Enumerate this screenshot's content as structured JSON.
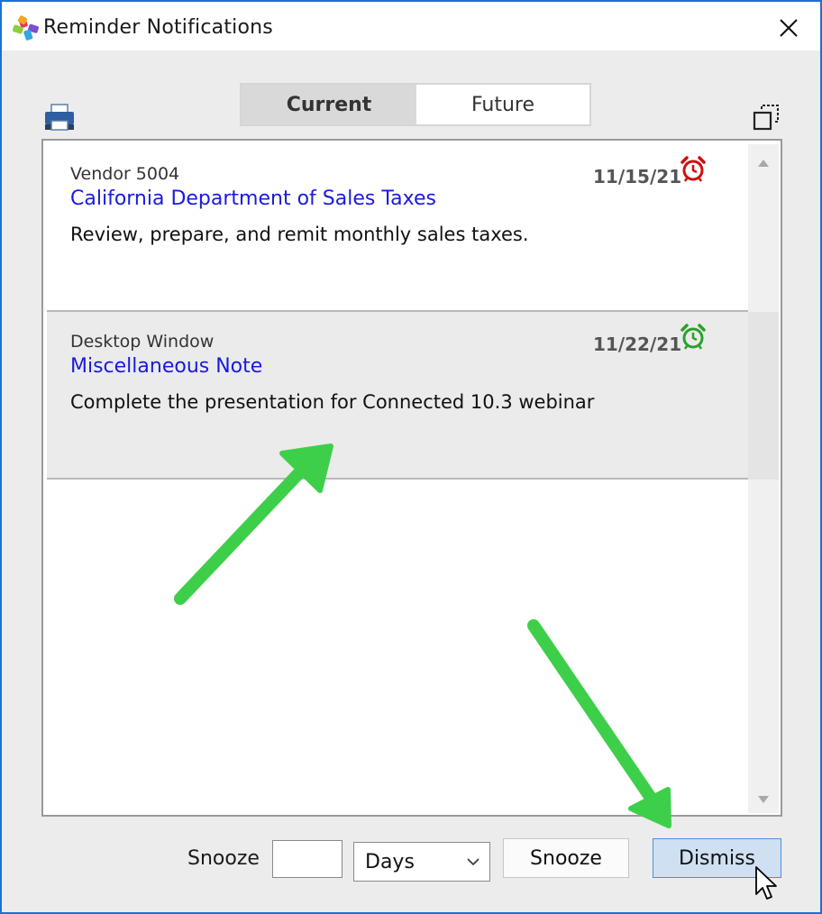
{
  "window": {
    "title": "Reminder Notifications"
  },
  "icons": {
    "app": "colorful-pinwheel-icon",
    "close": "close-icon",
    "print": "printer-icon",
    "popout": "popout-window-icon",
    "alarm": "alarm-clock-icon",
    "dropdown": "chevron-down-icon"
  },
  "tabs": [
    {
      "label": "Current",
      "selected": true
    },
    {
      "label": "Future",
      "selected": false
    }
  ],
  "reminders": [
    {
      "source": "Vendor 5004",
      "title": "California Department of Sales Taxes",
      "description": "Review, prepare, and remit monthly sales taxes.",
      "date": "11/15/21",
      "alarm_color": "#cc1010"
    },
    {
      "source": "Desktop Window",
      "title": "Miscellaneous Note",
      "description": "Complete the presentation for Connected 10.3 webinar",
      "date": "11/22/21",
      "alarm_color": "#2aa12a"
    }
  ],
  "footer": {
    "snooze_label": "Snooze",
    "snooze_value": "",
    "unit_selected": "Days",
    "snooze_button": "Snooze",
    "dismiss_button": "Dismiss"
  },
  "colors": {
    "link": "#1a1adc",
    "window_border": "#1c6fd6",
    "annotation_arrow": "#3ecf4a",
    "dismiss_bg": "#cfe0f2"
  }
}
